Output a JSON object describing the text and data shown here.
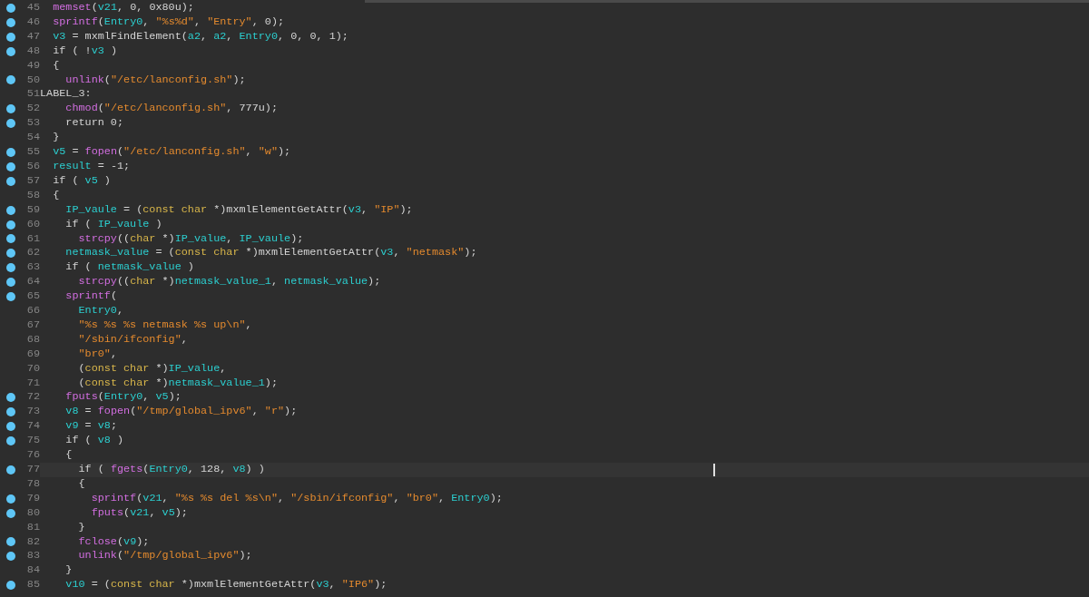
{
  "lines": [
    {
      "number": "45",
      "breakpoint": true,
      "selected": false,
      "tokens": [
        {
          "kind": "func",
          "text": "  memset"
        },
        {
          "kind": "plain",
          "text": "("
        },
        {
          "kind": "var",
          "text": "v21"
        },
        {
          "kind": "plain",
          "text": ", 0, 0x80u);"
        }
      ]
    },
    {
      "number": "46",
      "breakpoint": true,
      "selected": false,
      "tokens": [
        {
          "kind": "func",
          "text": "  sprintf"
        },
        {
          "kind": "plain",
          "text": "("
        },
        {
          "kind": "var",
          "text": "Entry0"
        },
        {
          "kind": "plain",
          "text": ", "
        },
        {
          "kind": "str",
          "text": "\"%s%d\""
        },
        {
          "kind": "plain",
          "text": ", "
        },
        {
          "kind": "str",
          "text": "\"Entry\""
        },
        {
          "kind": "plain",
          "text": ", 0);"
        }
      ]
    },
    {
      "number": "47",
      "breakpoint": true,
      "selected": false,
      "tokens": [
        {
          "kind": "var",
          "text": "  v3"
        },
        {
          "kind": "plain",
          "text": " = mxmlFindElement("
        },
        {
          "kind": "var",
          "text": "a2"
        },
        {
          "kind": "plain",
          "text": ", "
        },
        {
          "kind": "var",
          "text": "a2"
        },
        {
          "kind": "plain",
          "text": ", "
        },
        {
          "kind": "var",
          "text": "Entry0"
        },
        {
          "kind": "plain",
          "text": ", 0, 0, 1);"
        }
      ]
    },
    {
      "number": "48",
      "breakpoint": true,
      "selected": false,
      "tokens": [
        {
          "kind": "plain",
          "text": "  if ( !"
        },
        {
          "kind": "var",
          "text": "v3"
        },
        {
          "kind": "plain",
          "text": " )"
        }
      ]
    },
    {
      "number": "49",
      "breakpoint": false,
      "selected": false,
      "tokens": [
        {
          "kind": "plain",
          "text": "  {"
        }
      ]
    },
    {
      "number": "50",
      "breakpoint": true,
      "selected": false,
      "tokens": [
        {
          "kind": "func",
          "text": "    unlink"
        },
        {
          "kind": "plain",
          "text": "("
        },
        {
          "kind": "str",
          "text": "\"/etc/lanconfig.sh\""
        },
        {
          "kind": "plain",
          "text": ");"
        }
      ]
    },
    {
      "number": "51",
      "breakpoint": false,
      "selected": false,
      "tokens": [
        {
          "kind": "plain",
          "text": "LABEL_3:"
        }
      ]
    },
    {
      "number": "52",
      "breakpoint": true,
      "selected": false,
      "tokens": [
        {
          "kind": "func",
          "text": "    chmod"
        },
        {
          "kind": "plain",
          "text": "("
        },
        {
          "kind": "str",
          "text": "\"/etc/lanconfig.sh\""
        },
        {
          "kind": "plain",
          "text": ", 777u);"
        }
      ]
    },
    {
      "number": "53",
      "breakpoint": true,
      "selected": false,
      "tokens": [
        {
          "kind": "plain",
          "text": "    return 0;"
        }
      ]
    },
    {
      "number": "54",
      "breakpoint": false,
      "selected": false,
      "tokens": [
        {
          "kind": "plain",
          "text": "  }"
        }
      ]
    },
    {
      "number": "55",
      "breakpoint": true,
      "selected": false,
      "tokens": [
        {
          "kind": "var",
          "text": "  v5"
        },
        {
          "kind": "plain",
          "text": " = "
        },
        {
          "kind": "func",
          "text": "fopen"
        },
        {
          "kind": "plain",
          "text": "("
        },
        {
          "kind": "str",
          "text": "\"/etc/lanconfig.sh\""
        },
        {
          "kind": "plain",
          "text": ", "
        },
        {
          "kind": "str",
          "text": "\"w\""
        },
        {
          "kind": "plain",
          "text": ");"
        }
      ]
    },
    {
      "number": "56",
      "breakpoint": true,
      "selected": false,
      "tokens": [
        {
          "kind": "var",
          "text": "  result"
        },
        {
          "kind": "plain",
          "text": " = -1;"
        }
      ]
    },
    {
      "number": "57",
      "breakpoint": true,
      "selected": false,
      "tokens": [
        {
          "kind": "plain",
          "text": "  if ( "
        },
        {
          "kind": "var",
          "text": "v5"
        },
        {
          "kind": "plain",
          "text": " )"
        }
      ]
    },
    {
      "number": "58",
      "breakpoint": false,
      "selected": false,
      "tokens": [
        {
          "kind": "plain",
          "text": "  {"
        }
      ]
    },
    {
      "number": "59",
      "breakpoint": true,
      "selected": false,
      "tokens": [
        {
          "kind": "var",
          "text": "    IP_vaule"
        },
        {
          "kind": "plain",
          "text": " = ("
        },
        {
          "kind": "keyword",
          "text": "const char"
        },
        {
          "kind": "plain",
          "text": " *)mxmlElementGetAttr("
        },
        {
          "kind": "var",
          "text": "v3"
        },
        {
          "kind": "plain",
          "text": ", "
        },
        {
          "kind": "str",
          "text": "\"IP\""
        },
        {
          "kind": "plain",
          "text": ");"
        }
      ]
    },
    {
      "number": "60",
      "breakpoint": true,
      "selected": false,
      "tokens": [
        {
          "kind": "plain",
          "text": "    if ( "
        },
        {
          "kind": "var",
          "text": "IP_vaule"
        },
        {
          "kind": "plain",
          "text": " )"
        }
      ]
    },
    {
      "number": "61",
      "breakpoint": true,
      "selected": false,
      "tokens": [
        {
          "kind": "func",
          "text": "      strcpy"
        },
        {
          "kind": "plain",
          "text": "(("
        },
        {
          "kind": "keyword",
          "text": "char"
        },
        {
          "kind": "plain",
          "text": " *)"
        },
        {
          "kind": "var",
          "text": "IP_value"
        },
        {
          "kind": "plain",
          "text": ", "
        },
        {
          "kind": "var",
          "text": "IP_vaule"
        },
        {
          "kind": "plain",
          "text": ");"
        }
      ]
    },
    {
      "number": "62",
      "breakpoint": true,
      "selected": false,
      "tokens": [
        {
          "kind": "var",
          "text": "    netmask_value"
        },
        {
          "kind": "plain",
          "text": " = ("
        },
        {
          "kind": "keyword",
          "text": "const char"
        },
        {
          "kind": "plain",
          "text": " *)mxmlElementGetAttr("
        },
        {
          "kind": "var",
          "text": "v3"
        },
        {
          "kind": "plain",
          "text": ", "
        },
        {
          "kind": "str",
          "text": "\"netmask\""
        },
        {
          "kind": "plain",
          "text": ");"
        }
      ]
    },
    {
      "number": "63",
      "breakpoint": true,
      "selected": false,
      "tokens": [
        {
          "kind": "plain",
          "text": "    if ( "
        },
        {
          "kind": "var",
          "text": "netmask_value"
        },
        {
          "kind": "plain",
          "text": " )"
        }
      ]
    },
    {
      "number": "64",
      "breakpoint": true,
      "selected": false,
      "tokens": [
        {
          "kind": "func",
          "text": "      strcpy"
        },
        {
          "kind": "plain",
          "text": "(("
        },
        {
          "kind": "keyword",
          "text": "char"
        },
        {
          "kind": "plain",
          "text": " *)"
        },
        {
          "kind": "var",
          "text": "netmask_value_1"
        },
        {
          "kind": "plain",
          "text": ", "
        },
        {
          "kind": "var",
          "text": "netmask_value"
        },
        {
          "kind": "plain",
          "text": ");"
        }
      ]
    },
    {
      "number": "65",
      "breakpoint": true,
      "selected": false,
      "tokens": [
        {
          "kind": "func",
          "text": "    sprintf"
        },
        {
          "kind": "plain",
          "text": "("
        }
      ]
    },
    {
      "number": "66",
      "breakpoint": false,
      "selected": false,
      "tokens": [
        {
          "kind": "var",
          "text": "      Entry0"
        },
        {
          "kind": "plain",
          "text": ","
        }
      ]
    },
    {
      "number": "67",
      "breakpoint": false,
      "selected": false,
      "tokens": [
        {
          "kind": "str",
          "text": "      \"%s %s %s netmask %s up\\n\""
        },
        {
          "kind": "plain",
          "text": ","
        }
      ]
    },
    {
      "number": "68",
      "breakpoint": false,
      "selected": false,
      "tokens": [
        {
          "kind": "str",
          "text": "      \"/sbin/ifconfig\""
        },
        {
          "kind": "plain",
          "text": ","
        }
      ]
    },
    {
      "number": "69",
      "breakpoint": false,
      "selected": false,
      "tokens": [
        {
          "kind": "str",
          "text": "      \"br0\""
        },
        {
          "kind": "plain",
          "text": ","
        }
      ]
    },
    {
      "number": "70",
      "breakpoint": false,
      "selected": false,
      "tokens": [
        {
          "kind": "plain",
          "text": "      ("
        },
        {
          "kind": "keyword",
          "text": "const char"
        },
        {
          "kind": "plain",
          "text": " *)"
        },
        {
          "kind": "var",
          "text": "IP_value"
        },
        {
          "kind": "plain",
          "text": ","
        }
      ]
    },
    {
      "number": "71",
      "breakpoint": false,
      "selected": false,
      "tokens": [
        {
          "kind": "plain",
          "text": "      ("
        },
        {
          "kind": "keyword",
          "text": "const char"
        },
        {
          "kind": "plain",
          "text": " *)"
        },
        {
          "kind": "var",
          "text": "netmask_value_1"
        },
        {
          "kind": "plain",
          "text": ");"
        }
      ]
    },
    {
      "number": "72",
      "breakpoint": true,
      "selected": false,
      "tokens": [
        {
          "kind": "func",
          "text": "    fputs"
        },
        {
          "kind": "plain",
          "text": "("
        },
        {
          "kind": "var",
          "text": "Entry0"
        },
        {
          "kind": "plain",
          "text": ", "
        },
        {
          "kind": "var",
          "text": "v5"
        },
        {
          "kind": "plain",
          "text": ");"
        }
      ]
    },
    {
      "number": "73",
      "breakpoint": true,
      "selected": false,
      "tokens": [
        {
          "kind": "var",
          "text": "    v8"
        },
        {
          "kind": "plain",
          "text": " = "
        },
        {
          "kind": "func",
          "text": "fopen"
        },
        {
          "kind": "plain",
          "text": "("
        },
        {
          "kind": "str",
          "text": "\"/tmp/global_ipv6\""
        },
        {
          "kind": "plain",
          "text": ", "
        },
        {
          "kind": "str",
          "text": "\"r\""
        },
        {
          "kind": "plain",
          "text": ");"
        }
      ]
    },
    {
      "number": "74",
      "breakpoint": true,
      "selected": false,
      "tokens": [
        {
          "kind": "var",
          "text": "    v9"
        },
        {
          "kind": "plain",
          "text": " = "
        },
        {
          "kind": "var",
          "text": "v8"
        },
        {
          "kind": "plain",
          "text": ";"
        }
      ]
    },
    {
      "number": "75",
      "breakpoint": true,
      "selected": false,
      "tokens": [
        {
          "kind": "plain",
          "text": "    if ( "
        },
        {
          "kind": "var",
          "text": "v8"
        },
        {
          "kind": "plain",
          "text": " )"
        }
      ]
    },
    {
      "number": "76",
      "breakpoint": false,
      "selected": false,
      "tokens": [
        {
          "kind": "plain",
          "text": "    {"
        }
      ]
    },
    {
      "number": "77",
      "breakpoint": true,
      "selected": true,
      "tokens": [
        {
          "kind": "plain",
          "text": "      if ( "
        },
        {
          "kind": "func",
          "text": "fgets"
        },
        {
          "kind": "plain",
          "text": "("
        },
        {
          "kind": "var",
          "text": "Entry0"
        },
        {
          "kind": "plain",
          "text": ", 128, "
        },
        {
          "kind": "var",
          "text": "v8"
        },
        {
          "kind": "plain",
          "text": ") )"
        }
      ]
    },
    {
      "number": "78",
      "breakpoint": false,
      "selected": false,
      "tokens": [
        {
          "kind": "plain",
          "text": "      {"
        }
      ]
    },
    {
      "number": "79",
      "breakpoint": true,
      "selected": false,
      "tokens": [
        {
          "kind": "func",
          "text": "        sprintf"
        },
        {
          "kind": "plain",
          "text": "("
        },
        {
          "kind": "var",
          "text": "v21"
        },
        {
          "kind": "plain",
          "text": ", "
        },
        {
          "kind": "str",
          "text": "\"%s %s del %s\\n\""
        },
        {
          "kind": "plain",
          "text": ", "
        },
        {
          "kind": "str",
          "text": "\"/sbin/ifconfig\""
        },
        {
          "kind": "plain",
          "text": ", "
        },
        {
          "kind": "str",
          "text": "\"br0\""
        },
        {
          "kind": "plain",
          "text": ", "
        },
        {
          "kind": "var",
          "text": "Entry0"
        },
        {
          "kind": "plain",
          "text": ");"
        }
      ]
    },
    {
      "number": "80",
      "breakpoint": true,
      "selected": false,
      "tokens": [
        {
          "kind": "func",
          "text": "        fputs"
        },
        {
          "kind": "plain",
          "text": "("
        },
        {
          "kind": "var",
          "text": "v21"
        },
        {
          "kind": "plain",
          "text": ", "
        },
        {
          "kind": "var",
          "text": "v5"
        },
        {
          "kind": "plain",
          "text": ");"
        }
      ]
    },
    {
      "number": "81",
      "breakpoint": false,
      "selected": false,
      "tokens": [
        {
          "kind": "plain",
          "text": "      }"
        }
      ]
    },
    {
      "number": "82",
      "breakpoint": true,
      "selected": false,
      "tokens": [
        {
          "kind": "func",
          "text": "      fclose"
        },
        {
          "kind": "plain",
          "text": "("
        },
        {
          "kind": "var",
          "text": "v9"
        },
        {
          "kind": "plain",
          "text": ");"
        }
      ]
    },
    {
      "number": "83",
      "breakpoint": true,
      "selected": false,
      "tokens": [
        {
          "kind": "func",
          "text": "      unlink"
        },
        {
          "kind": "plain",
          "text": "("
        },
        {
          "kind": "str",
          "text": "\"/tmp/global_ipv6\""
        },
        {
          "kind": "plain",
          "text": ");"
        }
      ]
    },
    {
      "number": "84",
      "breakpoint": false,
      "selected": false,
      "tokens": [
        {
          "kind": "plain",
          "text": "    }"
        }
      ]
    },
    {
      "number": "85",
      "breakpoint": true,
      "selected": false,
      "tokens": [
        {
          "kind": "var",
          "text": "    v10"
        },
        {
          "kind": "plain",
          "text": " = ("
        },
        {
          "kind": "keyword",
          "text": "const char"
        },
        {
          "kind": "plain",
          "text": " *)mxmlElementGetAttr("
        },
        {
          "kind": "var",
          "text": "v3"
        },
        {
          "kind": "plain",
          "text": ", "
        },
        {
          "kind": "str",
          "text": "\"IP6\""
        },
        {
          "kind": "plain",
          "text": ");"
        }
      ]
    }
  ]
}
